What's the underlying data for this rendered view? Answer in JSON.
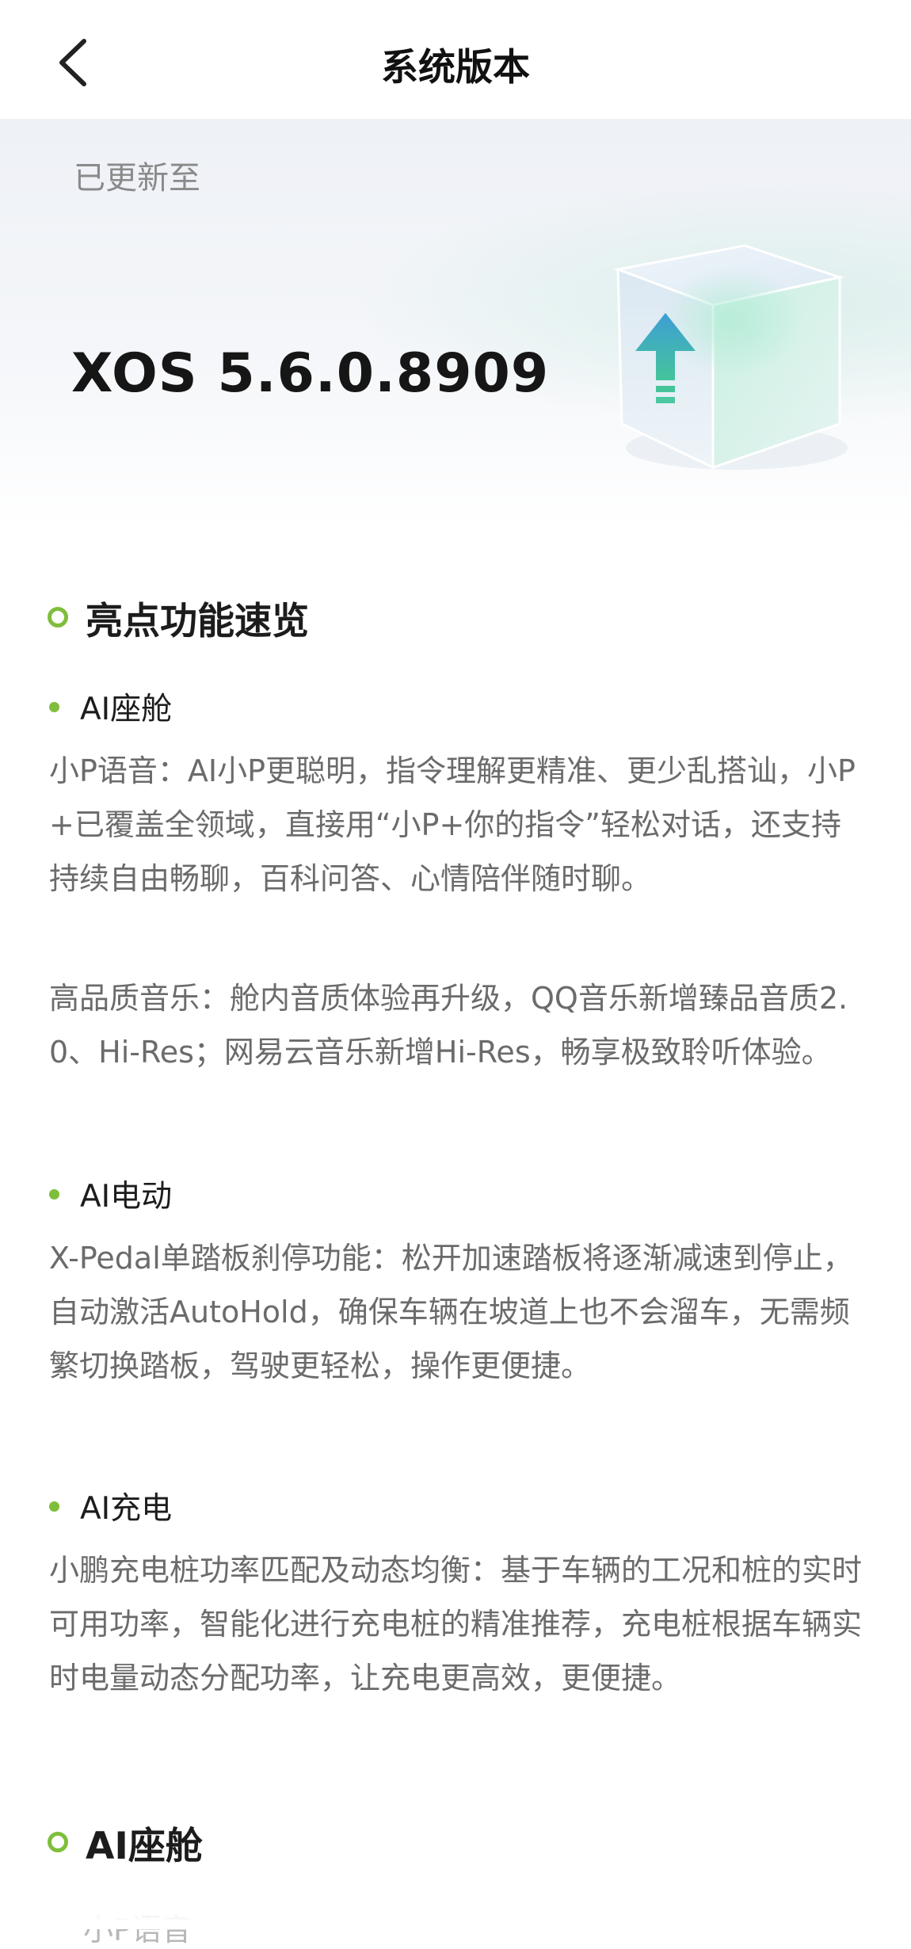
{
  "header": {
    "title": "系统版本",
    "back_icon": "chevron-left-icon"
  },
  "hero": {
    "label": "已更新至",
    "version": "XOS 5.6.0.8909",
    "illustration": "update-cube-icon"
  },
  "sections": [
    {
      "title": "亮点功能速览",
      "groups": [
        {
          "title": "AI座舱",
          "paragraphs": [
            "小P语音：AI小P更聪明，指令理解更精准、更少乱搭讪，小P+已覆盖全领域，直接用“小P+你的指令”轻松对话，还支持持续自由畅聊，百科问答、心情陪伴随时聊。",
            "高品质音乐：舱内音质体验再升级，QQ音乐新增臻品音质2.0、Hi-Res；网易云音乐新增Hi-Res，畅享极致聆听体验。"
          ]
        },
        {
          "title": "AI电动",
          "paragraphs": [
            "X-Pedal单踏板刹停功能：松开加速踏板将逐渐减速到停止，自动激活AutoHold，确保车辆在坡道上也不会溜车，无需频繁切换踏板，驾驶更轻松，操作更便捷。"
          ]
        },
        {
          "title": "AI充电",
          "paragraphs": [
            "小鹏充电桩功率匹配及动态均衡：基于车辆的工况和桩的实时可用功率，智能化进行充电桩的精准推荐，充电桩根据车辆实时电量动态分配功率，让充电更高效，更便捷。"
          ]
        }
      ]
    },
    {
      "title": "AI座舱",
      "partial_text": "小P语音"
    }
  ],
  "colors": {
    "accent": "#7fbe3a",
    "body_text": "#6b6b6b",
    "title_text": "#1c1c1c"
  }
}
